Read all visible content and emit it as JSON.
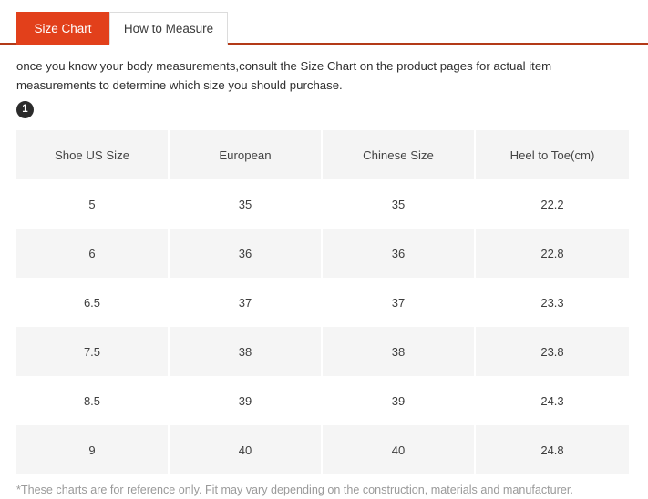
{
  "tabs": [
    {
      "label": "Size Chart",
      "active": true
    },
    {
      "label": "How to Measure",
      "active": false
    }
  ],
  "intro": {
    "text": "once you know your body measurements,consult the Size Chart on the product pages for actual item measurements to determine which size you should purchase.",
    "badge": "1"
  },
  "table": {
    "headers": [
      "Shoe US Size",
      "European",
      "Chinese Size",
      "Heel to Toe(cm)"
    ],
    "rows": [
      [
        "5",
        "35",
        "35",
        "22.2"
      ],
      [
        "6",
        "36",
        "36",
        "22.8"
      ],
      [
        "6.5",
        "37",
        "37",
        "23.3"
      ],
      [
        "7.5",
        "38",
        "38",
        "23.8"
      ],
      [
        "8.5",
        "39",
        "39",
        "24.3"
      ],
      [
        "9",
        "40",
        "40",
        "24.8"
      ]
    ]
  },
  "footnote": "*These charts are for reference only. Fit may vary depending on the construction, materials and manufacturer.",
  "colors": {
    "accent": "#e2401b",
    "rule": "#b33a18",
    "row_shade": "#f5f5f5",
    "header_shade": "#f4f4f4",
    "badge": "#2b2b2b"
  }
}
